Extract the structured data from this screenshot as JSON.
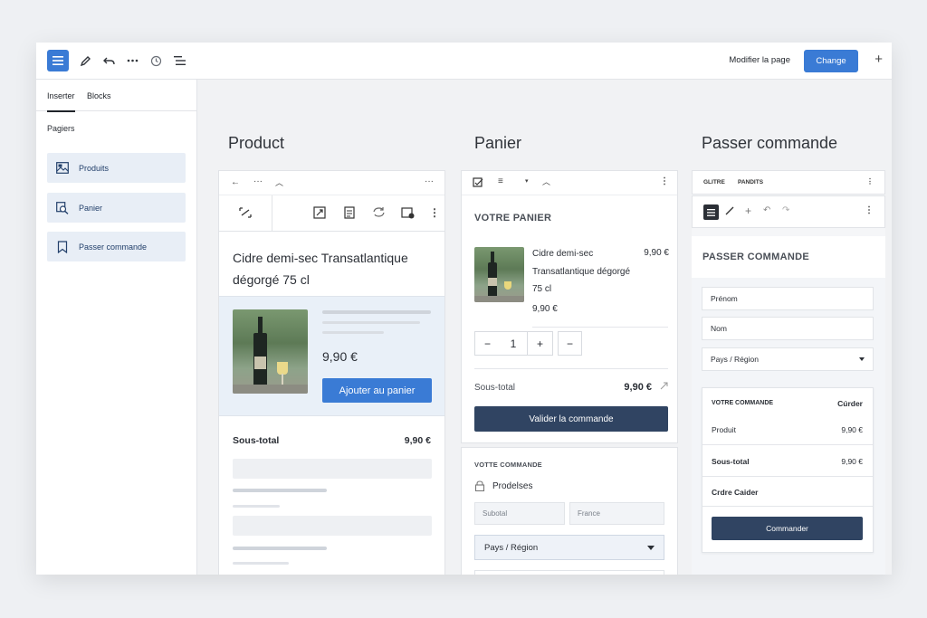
{
  "toolbar": {
    "icons": [
      "menu-icon",
      "pencil-icon",
      "undo-icon",
      "more-icon",
      "history-icon",
      "list-view-icon"
    ],
    "modify_label": "Modifier la page",
    "change_label": "Change",
    "add_label": "+"
  },
  "sidebar": {
    "tabs": [
      {
        "label": "Inserter",
        "active": true
      },
      {
        "label": "Blocks",
        "active": false
      }
    ],
    "section_label": "Pagiers",
    "items": [
      {
        "label": "Produits",
        "icon": "image-icon"
      },
      {
        "label": "Panier",
        "icon": "search-cart-icon"
      },
      {
        "label": "Passer commande",
        "icon": "bookmark-icon"
      }
    ]
  },
  "product": {
    "column_title": "Product",
    "name": "Cidre demi-sec Transatlantique dégorgé 75 cl",
    "price": "9,90 €",
    "add_to_cart": "Ajouter au panier",
    "subtotal_label": "Sous-total",
    "subtotal_value": "9,90 €"
  },
  "cart": {
    "column_title": "Panier",
    "heading": "VOTRE PANIER",
    "item_name": "Cidre demi-sec Transatlantique dégorgé 75 cl",
    "item_price_right": "9,90 €",
    "item_price": "9,90 €",
    "qty_minus": "−",
    "qty_value": "1",
    "qty_plus": "+",
    "remove": "−",
    "subtotal_label": "Sous-total",
    "subtotal_value": "9,90 €",
    "validate_button": "Valider la commande",
    "order_heading": "VOTTE COMMANDE",
    "products_label": "Prodelses",
    "subtotal_placeholder": "Subotal",
    "country_placeholder": "France",
    "region_select": "Pays / Région"
  },
  "checkout": {
    "column_title": "Passer commande",
    "tabs": [
      "GLITRE",
      "PANDITS"
    ],
    "heading": "PASSER COMMANDE",
    "first_name": "Prénom",
    "last_name": "Nom",
    "region_select": "Pays / Région",
    "summary_title": "VOTRE COMMANDE",
    "summary_action": "Cúrder",
    "product_label": "Produit",
    "product_value": "9,90 €",
    "subtotal_label": "Sous-total",
    "subtotal_value": "9,90 €",
    "order_label": "Crdre Caider",
    "order_button": "Commander"
  },
  "colors": {
    "accent": "#3a7bd5",
    "dark_button": "#304462",
    "sidebar_item_bg": "#e8eef6"
  }
}
